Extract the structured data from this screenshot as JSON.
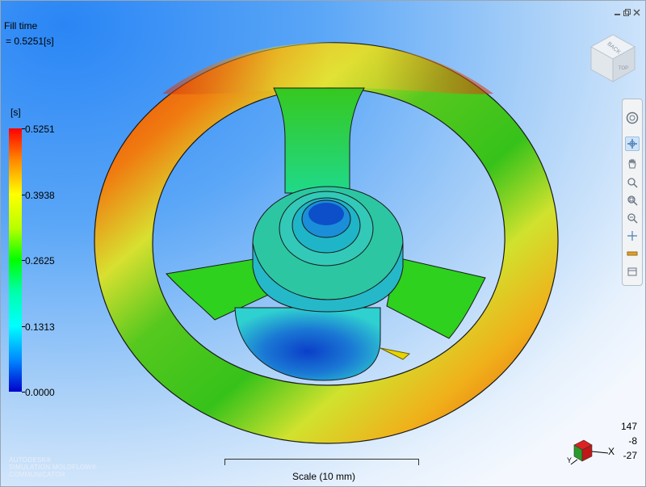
{
  "result": {
    "title": "Fill time",
    "value": "= 0.5251[s]"
  },
  "legend": {
    "unit": "[s]",
    "ticks": [
      "0.5251",
      "0.3938",
      "0.2625",
      "0.1313",
      "0.0000"
    ]
  },
  "scale": {
    "label": "Scale (10 mm)"
  },
  "viewcube": {
    "top_face": "TOP",
    "back_face": "BACK"
  },
  "coordinates": {
    "x": "147",
    "y": "-8",
    "z": "-27"
  },
  "triad": {
    "x_label": "X",
    "y_label": "Y"
  },
  "logo": {
    "line1": "AUTODESK®",
    "line2": "SIMULATION MOLDFLOW®",
    "line3": "COMMUNICATOR"
  },
  "window_controls": [
    "minimize-icon",
    "restore-icon",
    "close-icon"
  ],
  "nav_tools": [
    "steering-wheel-icon",
    "pan-cross-icon",
    "pan-hand-icon",
    "zoom-realtime-icon",
    "zoom-window-icon",
    "zoom-extents-icon",
    "orbit-icon",
    "ruler-icon",
    "clip-icon"
  ]
}
